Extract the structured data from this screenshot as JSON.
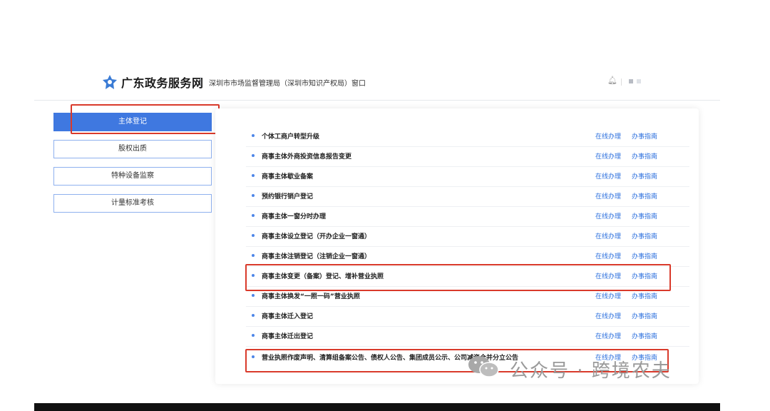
{
  "header": {
    "site_name": "广东政务服务网",
    "window_title": "深圳市市场监督管理局（深圳市知识产权局）窗口"
  },
  "sidebar": {
    "items": [
      {
        "label": "主体登记",
        "active": true
      },
      {
        "label": "股权出质",
        "active": false
      },
      {
        "label": "特种设备监察",
        "active": false
      },
      {
        "label": "计量标准考核",
        "active": false
      }
    ]
  },
  "services": {
    "online_label": "在线办理",
    "guide_label": "办事指南",
    "items": [
      "个体工商户转型升级",
      "商事主体外商投资信息报告变更",
      "商事主体歇业备案",
      "预约银行销户登记",
      "商事主体一窗分时办理",
      "商事主体设立登记（开办企业一窗通）",
      "商事主体注销登记（注销企业一窗通）",
      "商事主体变更（备案）登记、增补营业执照",
      "商事主体换发“一照一码”营业执照",
      "商事主体迁入登记",
      "商事主体迁出登记",
      "营业执照作废声明、清算组备案公告、债权人公告、集团成员公示、公司减资合并分立公告"
    ]
  },
  "watermark": {
    "text": "公众号 · 跨境农夫",
    "icon": "wechat-icon"
  },
  "colors": {
    "accent": "#3f78e0",
    "link": "#2b6fde",
    "highlight": "#d93a2b"
  }
}
